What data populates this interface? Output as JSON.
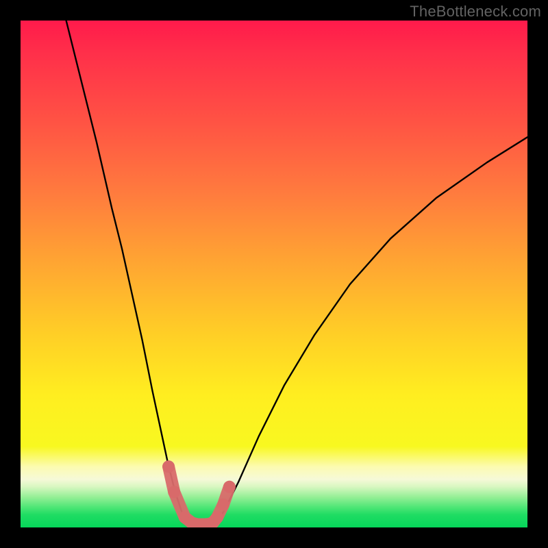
{
  "watermark": "TheBottleneck.com",
  "chart_data": {
    "type": "line",
    "title": "",
    "xlabel": "",
    "ylabel": "",
    "xlim": [
      0,
      100
    ],
    "ylim": [
      0,
      100
    ],
    "grid": false,
    "series": [
      {
        "name": "left-branch",
        "x": [
          9,
          12,
          15,
          18,
          20,
          22,
          24,
          26,
          27.5,
          29,
          30.5,
          32,
          33
        ],
        "values": [
          100,
          88,
          76,
          63,
          55,
          46,
          37,
          27,
          20,
          13,
          7,
          2.5,
          0.8
        ]
      },
      {
        "name": "right-branch",
        "x": [
          38,
          40,
          43,
          47,
          52,
          58,
          65,
          73,
          82,
          92,
          100
        ],
        "values": [
          0.8,
          3,
          9,
          18,
          28,
          38,
          48,
          57,
          65,
          72,
          77
        ]
      },
      {
        "name": "floor",
        "x": [
          33,
          34.5,
          36,
          37,
          38
        ],
        "values": [
          0.8,
          0.4,
          0.4,
          0.5,
          0.8
        ]
      }
    ],
    "markers": {
      "color": "#d86a6a",
      "points_x": [
        29.2,
        30.3,
        32.4,
        33.8,
        35.0,
        36.2,
        37.3,
        38.0,
        38.8,
        40.0,
        41.2
      ],
      "points_y": [
        12.0,
        7.0,
        2.0,
        0.9,
        0.6,
        0.6,
        0.7,
        1.0,
        2.0,
        4.5,
        8.0
      ]
    },
    "annotations": []
  },
  "colors": {
    "background_frame": "#000000",
    "curve": "#000000",
    "marker": "#d86a6a",
    "watermark": "#636363"
  }
}
